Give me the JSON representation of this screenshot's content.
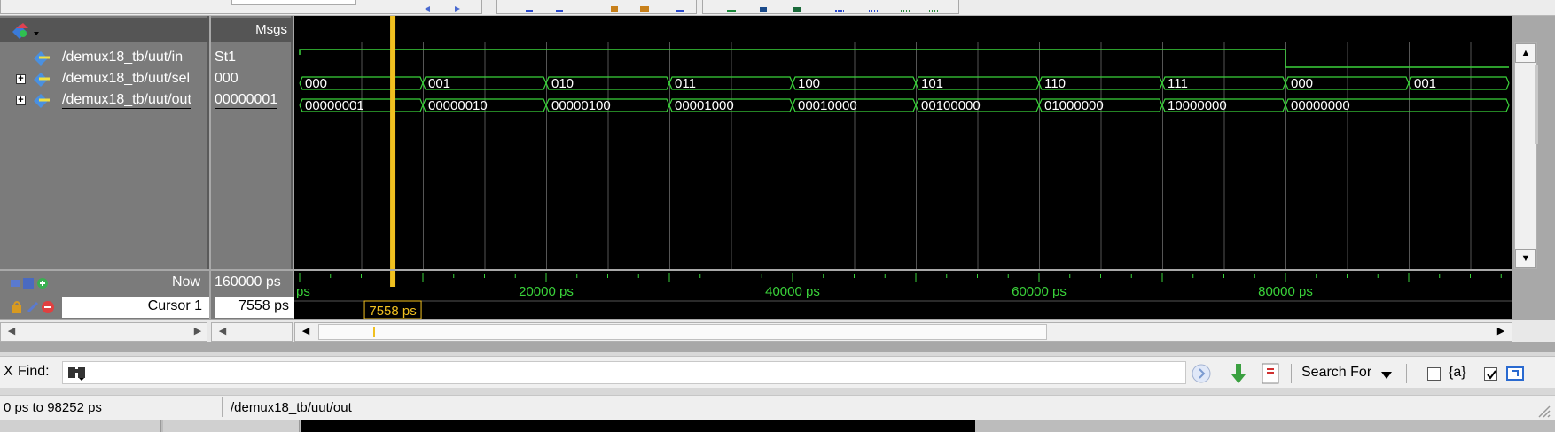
{
  "toolbar": {},
  "names_header": {},
  "values_header": {
    "label": "Msgs"
  },
  "signals": [
    {
      "name": "/demux18_tb/uut/in",
      "value": "St1",
      "expandable": false
    },
    {
      "name": "/demux18_tb/uut/sel",
      "value": "000",
      "expandable": true
    },
    {
      "name": "/demux18_tb/uut/out",
      "value": "00000001",
      "expandable": true
    }
  ],
  "waveform": {
    "in_values": [
      "1",
      "0"
    ],
    "sel_values": [
      "000",
      "001",
      "010",
      "011",
      "100",
      "101",
      "110",
      "111",
      "000",
      "001"
    ],
    "out_values": [
      "00000001",
      "00000010",
      "00000100",
      "00001000",
      "00010000",
      "00100000",
      "01000000",
      "10000000",
      "00000000"
    ],
    "signal_colors": {
      "trace": "#3ad23a",
      "cursor": "#f0c020",
      "background": "#000000"
    }
  },
  "timeline": {
    "ticks": [
      "ps",
      "20000 ps",
      "40000 ps",
      "60000 ps",
      "80000 ps"
    ],
    "cursor_label": "7558 ps",
    "cursor_time_ps": 7558
  },
  "cursors": {
    "now_label": "Now",
    "now_value": "160000 ps",
    "cursor_label": "Cursor 1",
    "cursor_value": "7558 ps"
  },
  "find": {
    "close_label": "X",
    "label": "Find:",
    "value": "",
    "search_for_label": "Search For",
    "option_label": "{a}"
  },
  "status": {
    "range": "0 ps to 98252 ps",
    "path": "/demux18_tb/uut/out"
  }
}
